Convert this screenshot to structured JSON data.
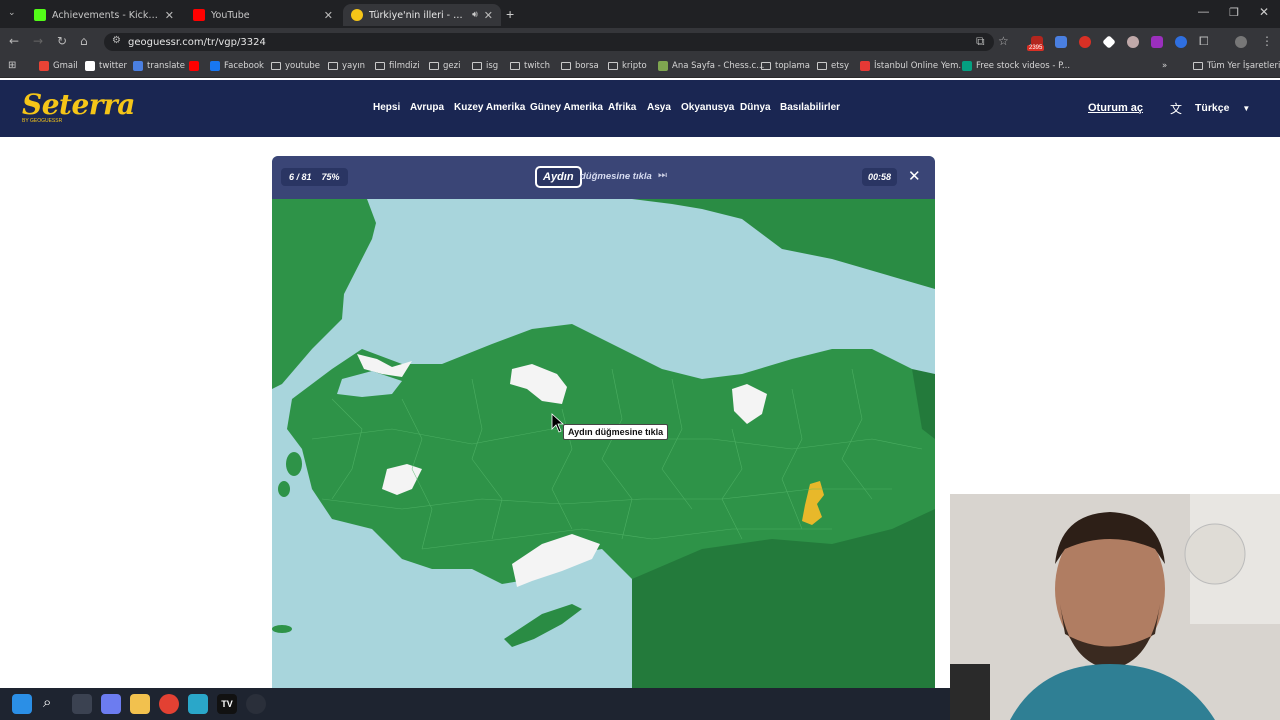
{
  "browser": {
    "tabs": [
      {
        "label": "Achievements - Kick Dashboard",
        "icon": "kick-icon",
        "color": "#53fc18"
      },
      {
        "label": "YouTube",
        "icon": "youtube-icon",
        "color": "#ff0000"
      },
      {
        "label": "Türkiye'nin illeri - Harita Te",
        "icon": "seterra-icon",
        "color": "#f5c518"
      }
    ],
    "url": "geoguessr.com/tr/vgp/3324",
    "extension_badge": "2395",
    "bookmarks": [
      {
        "label": "Gmail",
        "icon": "gmail-icon"
      },
      {
        "label": "twitter",
        "icon": "x-icon"
      },
      {
        "label": "translate",
        "icon": "translate-icon"
      },
      {
        "label": "",
        "icon": "youtube-icon"
      },
      {
        "label": "Facebook",
        "icon": "facebook-icon"
      },
      {
        "label": "youtube",
        "icon": "folder-icon"
      },
      {
        "label": "yayın",
        "icon": "folder-icon"
      },
      {
        "label": "filmdizi",
        "icon": "folder-icon"
      },
      {
        "label": "gezi",
        "icon": "folder-icon"
      },
      {
        "label": "isg",
        "icon": "folder-icon"
      },
      {
        "label": "twitch",
        "icon": "folder-icon"
      },
      {
        "label": "borsa",
        "icon": "folder-icon"
      },
      {
        "label": "kripto",
        "icon": "folder-icon"
      },
      {
        "label": "Ana Sayfa - Chess.c...",
        "icon": "chess-icon"
      },
      {
        "label": "toplama",
        "icon": "folder-icon"
      },
      {
        "label": "etsy",
        "icon": "folder-icon"
      },
      {
        "label": "İstanbul Online Yem...",
        "icon": "yemek-icon"
      },
      {
        "label": "Free stock videos - P...",
        "icon": "pexels-icon"
      }
    ],
    "all_bookmarks": "Tüm Yer İşaretleri"
  },
  "site": {
    "logo": "Seterra",
    "logo_sub": "BY GEOGUESSR",
    "nav": [
      "Hepsi",
      "Avrupa",
      "Kuzey Amerika",
      "Güney Amerika",
      "Afrika",
      "Asya",
      "Okyanusya",
      "Dünya",
      "Basılabilirler"
    ],
    "signin": "Oturum aç",
    "language": "Türkçe"
  },
  "game": {
    "progress": "6 / 81",
    "percent": "75%",
    "target": "Aydın",
    "instruction": "düğmesine tıkla",
    "timer": "00:58",
    "tooltip": "Aydın düğmesine tıkla",
    "colors": {
      "land": "#2e9348",
      "land_dark": "#237a3b",
      "sea": "#a8d5dc",
      "found": "#f4f4f4",
      "highlight": "#e8b82a"
    }
  }
}
